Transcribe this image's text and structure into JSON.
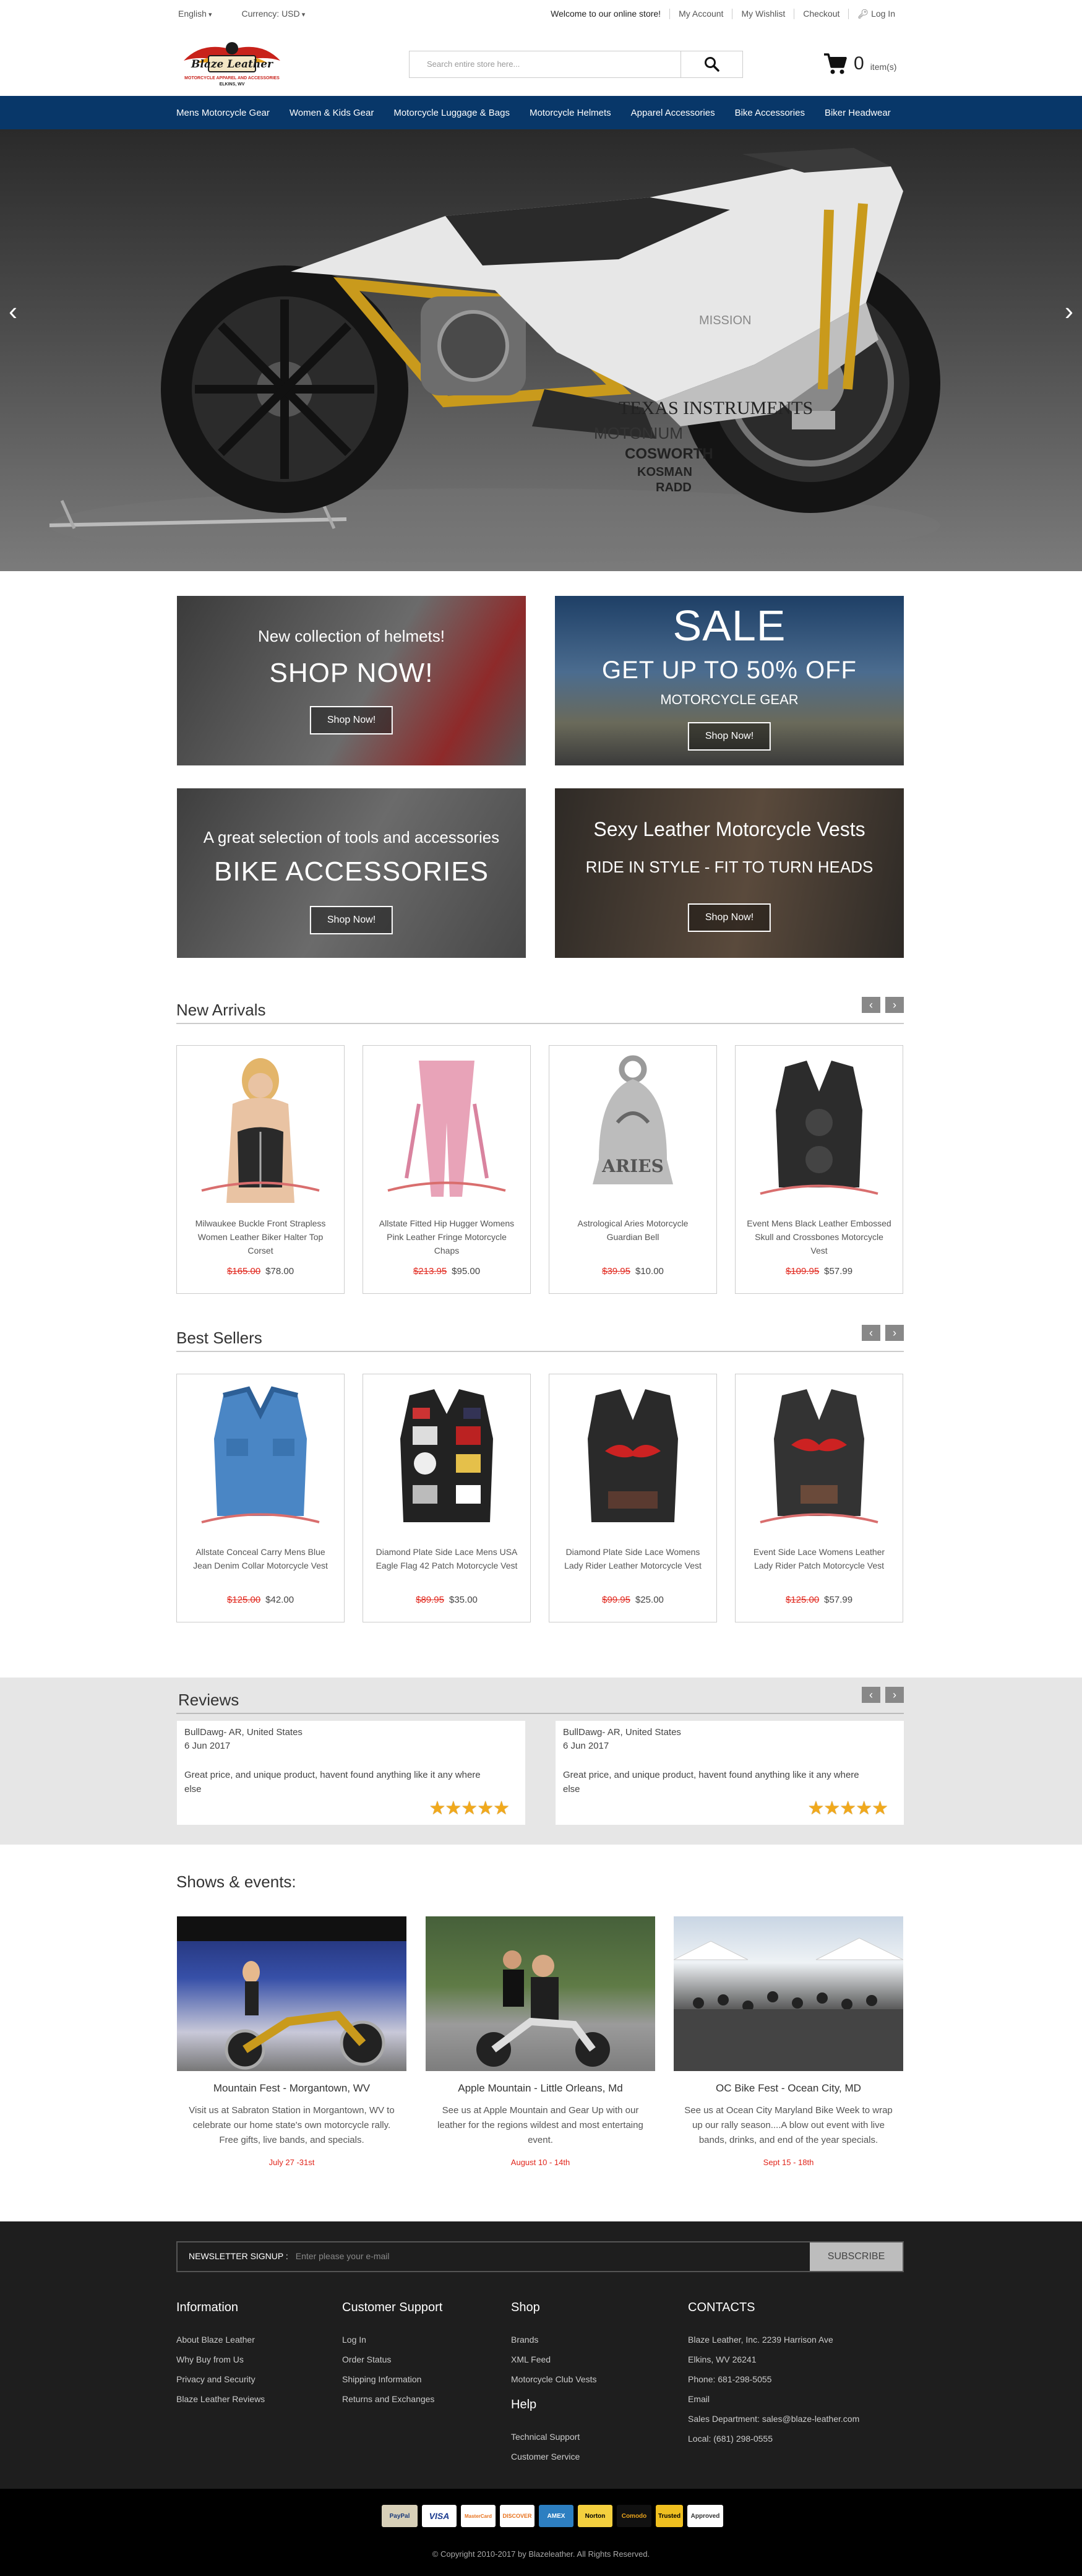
{
  "topbar": {
    "language": "English",
    "currency": "Currency: USD",
    "welcome": "Welcome to our online store!",
    "my_account": "My Account",
    "my_wishlist": "My Wishlist",
    "checkout": "Checkout",
    "login": "Log In"
  },
  "header": {
    "logo_text": "Blaze Leather",
    "logo_tagline": "MOTORCYCLE APPAREL AND ACCESSORIES",
    "logo_location": "ELKINS, WV",
    "search_placeholder": "Search entire store here...",
    "cart_count": "0",
    "cart_items_label": "item(s)"
  },
  "nav": [
    "Mens Motorcycle Gear",
    "Women & Kids Gear",
    "Motorcycle Luggage & Bags",
    "Motorcycle Helmets",
    "Apparel Accessories",
    "Bike Accessories",
    "Biker Headwear"
  ],
  "hero": {
    "brand_texas": "TEXAS INSTRUMENTS",
    "brand_motonium": "MOTONIUM",
    "brand_cosworth": "COSWORTH",
    "brand_kosman": "KOSMAN",
    "brand_radd": "RADD",
    "brand_mission": "MISSION"
  },
  "promos": [
    {
      "line1": "New collection of helmets!",
      "line2": "SHOP NOW!",
      "button": "Shop Now!"
    },
    {
      "line1": "SALE",
      "line2": "GET UP TO 50% OFF",
      "line3": "MOTORCYCLE GEAR",
      "button": "Shop Now!"
    },
    {
      "line1": "A great selection of tools and accessories",
      "line2": "BIKE ACCESSORIES",
      "button": "Shop Now!"
    },
    {
      "line1": "Sexy Leather Motorcycle Vests",
      "line2": "RIDE IN STYLE - FIT TO TURN HEADS",
      "button": "Shop Now!"
    }
  ],
  "new_arrivals": {
    "title": "New Arrivals",
    "items": [
      {
        "name": "Milwaukee Buckle Front Strapless Women Leather Biker Halter Top Corset",
        "old_price": "$165.00",
        "price": "$78.00"
      },
      {
        "name": "Allstate Fitted Hip Hugger Womens Pink Leather Fringe Motorcycle Chaps",
        "old_price": "$213.95",
        "price": "$95.00"
      },
      {
        "name": "Astrological Aries Motorcycle Guardian Bell",
        "old_price": "$39.95",
        "price": "$10.00",
        "bell_text": "ARIES"
      },
      {
        "name": "Event Mens Black Leather Embossed Skull and Crossbones Motorcycle Vest",
        "old_price": "$109.95",
        "price": "$57.99"
      }
    ]
  },
  "best_sellers": {
    "title": "Best Sellers",
    "items": [
      {
        "name": "Allstate Conceal Carry Mens Blue Jean Denim Collar Motorcycle Vest",
        "old_price": "$125.00",
        "price": "$42.00"
      },
      {
        "name": "Diamond Plate Side Lace Mens USA Eagle Flag 42 Patch Motorcycle Vest",
        "old_price": "$89.95",
        "price": "$35.00"
      },
      {
        "name": "Diamond Plate Side Lace Womens Lady Rider Leather Motorcycle Vest",
        "old_price": "$99.95",
        "price": "$25.00"
      },
      {
        "name": "Event Side Lace Womens Leather Lady Rider Patch Motorcycle Vest",
        "old_price": "$125.00",
        "price": "$57.99"
      }
    ]
  },
  "reviews": {
    "title": "Reviews",
    "items": [
      {
        "author": "BullDawg- AR, United States",
        "date": "6 Jun 2017",
        "text": "Great price, and unique product, havent found anything like it any where else",
        "stars": 5
      },
      {
        "author": "BullDawg- AR, United States",
        "date": "6 Jun 2017",
        "text": "Great price, and unique product, havent found anything like it any where else",
        "stars": 5
      }
    ]
  },
  "events": {
    "title": "Shows & events:",
    "items": [
      {
        "title": "Mountain Fest - Morgantown, WV",
        "desc": "Visit us at Sabraton Station in Morgantown, WV to celebrate our home state's own motorcycle rally. Free gifts, live bands, and specials.",
        "date": "July 27 -31st"
      },
      {
        "title": "Apple Mountain - Little Orleans, Md",
        "desc": "See us at Apple Mountain and Gear Up with our leather for the regions wildest and most entertaing event.",
        "date": "August 10 - 14th"
      },
      {
        "title": "OC Bike Fest - Ocean City, MD",
        "desc": "See us at Ocean City Maryland Bike Week to wrap up our rally season....A blow out event with live bands, drinks, and end of the year specials.",
        "date": "Sept 15 - 18th"
      }
    ]
  },
  "footer": {
    "newsletter_label": "NEWSLETTER SIGNUP :",
    "newsletter_placeholder": "Enter please your e-mail",
    "subscribe": "SUBSCRIBE",
    "information": {
      "title": "Information",
      "links": [
        "About Blaze Leather",
        "Why Buy from Us",
        "Privacy and Security",
        "Blaze Leather Reviews"
      ]
    },
    "support": {
      "title": "Customer Support",
      "links": [
        "Log In",
        "Order Status",
        "Shipping Information",
        "Returns and Exchanges"
      ]
    },
    "shop": {
      "title": "Shop",
      "links": [
        "Brands",
        "XML Feed",
        "Motorcycle Club Vests"
      ]
    },
    "help": {
      "title": "Help",
      "links": [
        "Technical Support",
        "Customer Service"
      ]
    },
    "contacts": {
      "title": "CONTACTS",
      "lines": [
        "Blaze Leather, Inc. 2239 Harrison Ave",
        "Elkins, WV 26241",
        "Phone: 681-298-5055",
        "Email",
        "Sales Department: sales@blaze-leather.com",
        "Local: (681) 298-0555"
      ]
    },
    "payments": [
      "PayPal",
      "VISA",
      "MasterCard",
      "DISCOVER",
      "AMEX",
      "Norton",
      "Comodo",
      "Trusted",
      "Approved"
    ],
    "copyright": "© Copyright 2010-2017 by Blazeleather. All Rights Reserved."
  },
  "colors": {
    "nav_bg": "#083769",
    "sale_red": "#e1261c",
    "footer_bg": "#1e1e1e",
    "review_band": "#e6e6e6"
  }
}
